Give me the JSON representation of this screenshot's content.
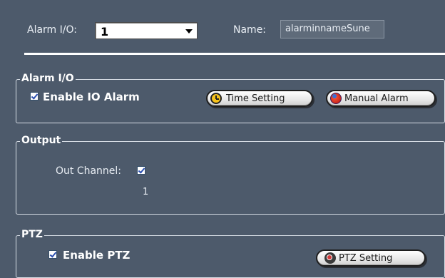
{
  "top": {
    "alarm_io_label": "Alarm I/O:",
    "alarm_io_value": "1",
    "name_label": "Name:",
    "name_value": "alarminnameSune"
  },
  "alarm_group": {
    "title": "Alarm I/O",
    "enable_label": "Enable IO Alarm",
    "enable_checked": true,
    "time_setting_label": "Time Setting",
    "manual_alarm_label": "Manual Alarm"
  },
  "output_group": {
    "title": "Output",
    "out_channel_label": "Out Channel:",
    "channel_number": "1",
    "channel_checked": true
  },
  "ptz_group": {
    "title": "PTZ",
    "enable_label": "Enable PTZ",
    "enable_checked": true,
    "setting_label": "PTZ Setting"
  },
  "colors": {
    "background": "#4d5a6b",
    "text": "#ffffff"
  }
}
